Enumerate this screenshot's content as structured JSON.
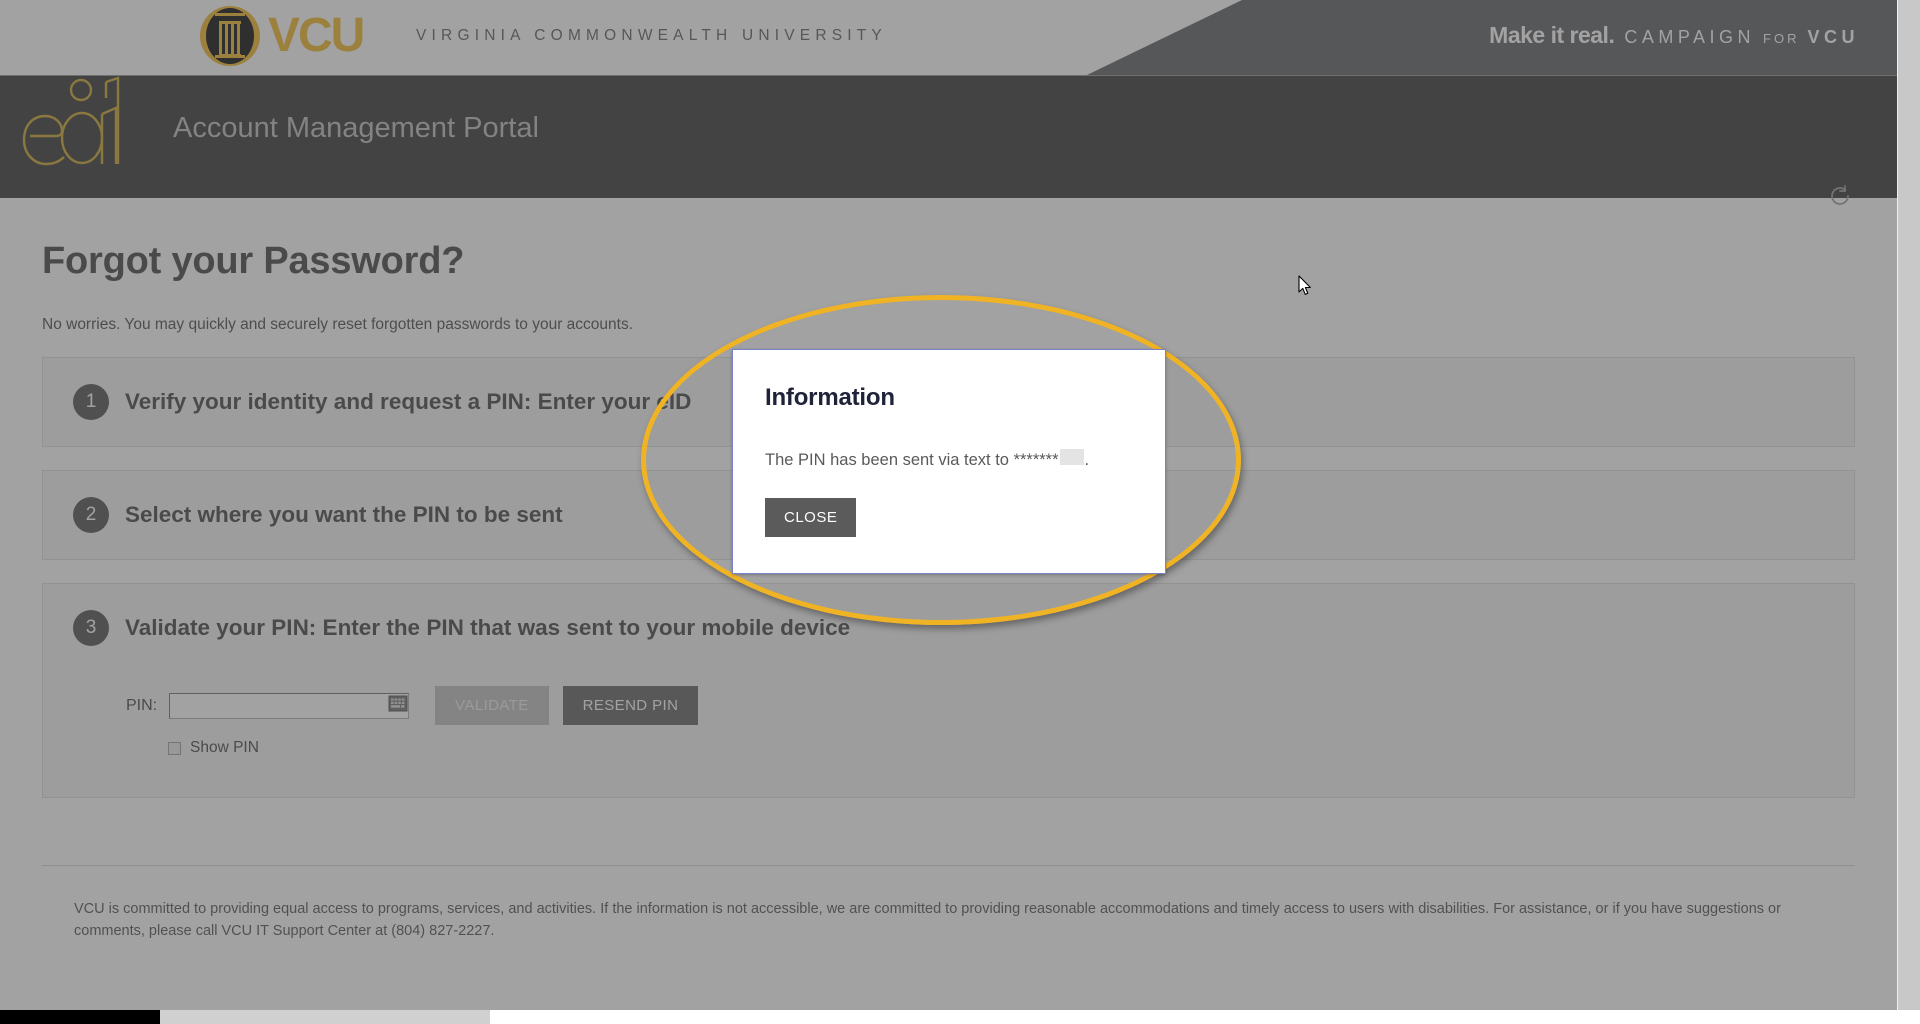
{
  "brand": {
    "logo_word": "VCU",
    "university_name": "VIRGINIA COMMONWEALTH UNIVERSITY",
    "campaign_tagline": "Make it real.",
    "campaign_word": "CAMPAIGN",
    "campaign_for": "FOR",
    "campaign_vcu": "VCU",
    "gold": "#f0b323",
    "slate": "#58595b"
  },
  "portal": {
    "logo_text": "eid",
    "title": "Account Management Portal",
    "refresh_icon": "refresh-ccw-icon",
    "header_bg": "#2d2d2d"
  },
  "main": {
    "page_title": "Forgot your Password?",
    "page_subtitle": "No worries. You may quickly and securely reset forgotten passwords to your accounts.",
    "steps": [
      {
        "number": "1",
        "title": "Verify your identity and request a PIN: Enter your eID"
      },
      {
        "number": "2",
        "title": "Select where you want the PIN to be sent"
      },
      {
        "number": "3",
        "title": "Validate your PIN: Enter the PIN that was sent to your mobile device"
      }
    ],
    "pin_form": {
      "label": "PIN:",
      "value": "",
      "placeholder": "",
      "keyboard_icon": "virtual-keyboard-icon",
      "validate_label": "VALIDATE",
      "resend_label": "RESEND PIN",
      "show_pin_label": "Show PIN",
      "show_pin_checked": false
    }
  },
  "dialog": {
    "title": "Information",
    "message_prefix": "The PIN has been sent via text to",
    "masked_number": "*******",
    "message_suffix": ".",
    "close_label": "CLOSE",
    "border_color": "#7b83c8"
  },
  "footer": {
    "text": "VCU is committed to providing equal access to programs, services, and activities. If the information is not accessible, we are committed to providing reasonable accommodations and timely access to users with disabilities. For assistance, or if you have suggestions or comments, please call VCU IT Support Center at (804) 827-2227."
  },
  "overlay": {
    "highlight_color": "#f0b323",
    "dim_color": "rgba(85,85,85,0.55)"
  }
}
